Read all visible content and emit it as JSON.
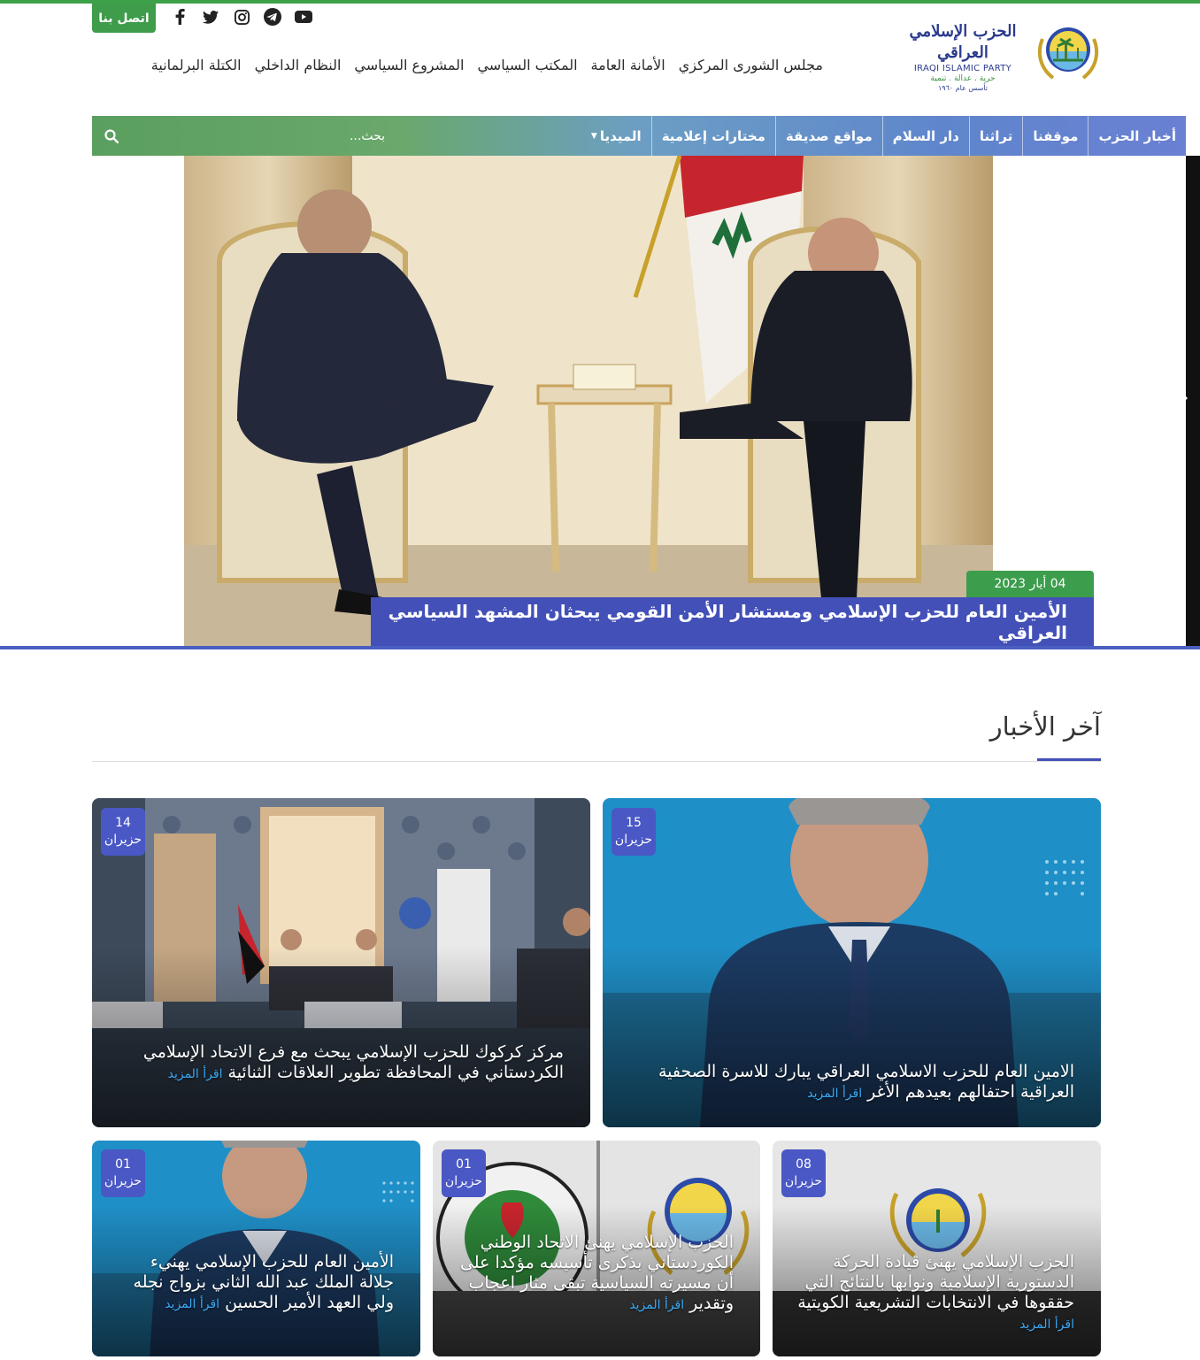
{
  "header": {
    "contact_label": "اتصل بنا",
    "social_icons": [
      "facebook-icon",
      "twitter-icon",
      "instagram-icon",
      "telegram-icon",
      "youtube-icon"
    ],
    "logo": {
      "arabic": "الحزب الإسلامي العراقي",
      "english": "IRAQI ISLAMIC PARTY",
      "slogan": "حرية . عدالة . تنمية",
      "founded": "تأسس عام ١٩٦٠"
    },
    "top_links": [
      "مجلس الشورى المركزي",
      "الأمانة العامة",
      "المكتب السياسي",
      "المشروع السياسي",
      "النظام الداخلي",
      "الكتلة البرلمانية"
    ]
  },
  "nav": {
    "items": [
      "أخبار الحزب",
      "موقفنا",
      "تراثنا",
      "دار السلام",
      "مواقع صديقة",
      "مختارات إعلامية",
      "الميديا"
    ],
    "search_placeholder": "بحث..."
  },
  "hero": {
    "date": "04 أيار 2023",
    "title": "الأمين العام للحزب الإسلامي ومستشار الأمن القومي يبحثان المشهد السياسي العراقي"
  },
  "latest": {
    "title": "آخر الأخبار",
    "read_more": "اقرأ المزيد",
    "cards": [
      {
        "day": "15",
        "month": "حزيران",
        "title": "الامين العام للحزب الاسلامي العراقي يبارك للاسرة الصحفية العراقية احتفالهم بعيدهم الأغر"
      },
      {
        "day": "14",
        "month": "حزيران",
        "title": "مركز كركوك للحزب الإسلامي يبحث مع فرع الاتحاد الإسلامي الكردستاني في المحافظة تطوير العلاقات الثنائية"
      },
      {
        "day": "08",
        "month": "حزيران",
        "title": "الحزب الإسلامي يهنئ قيادة الحركة الدستورية الإسلامية ونوابها بالنتائج التي حققوها في الانتخابات التشريعية الكويتية"
      },
      {
        "day": "01",
        "month": "حزيران",
        "title": "الحزب الإسلامي يهنئ الاتحاد الوطني الكوردستاني بذكرى تأسيسه مؤكدا على أن مسيرته السياسية تبقى مثار اعجاب وتقدير"
      },
      {
        "day": "01",
        "month": "حزيران",
        "title": "الأمين العام للحزب الإسلامي يهنيء جلالة الملك عبد الله الثاني بزواج نجله ولي العهد الأمير الحسين"
      }
    ]
  },
  "colors": {
    "green": "#3e9c4a",
    "blue": "#4350b8",
    "link": "#3ba9f5"
  }
}
